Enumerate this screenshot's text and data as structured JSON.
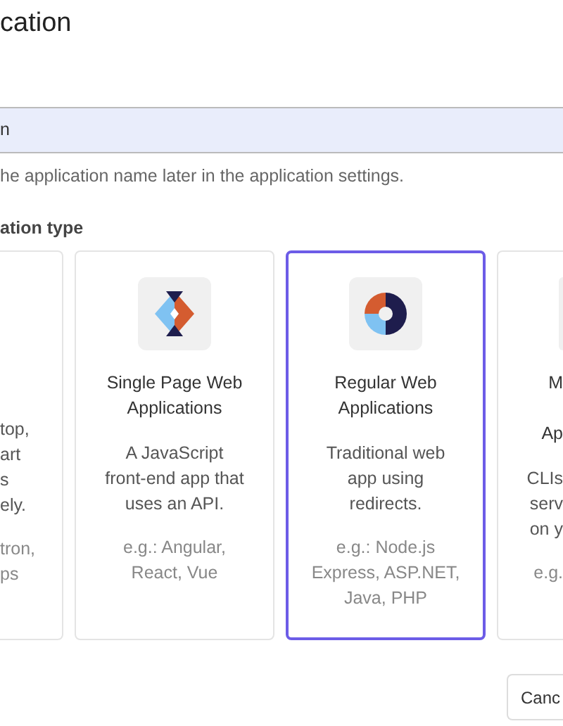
{
  "dialog_title": "cation",
  "name_field": {
    "value": "n"
  },
  "helper_text": "he application name later in the application settings.",
  "type_label": "ation type",
  "app_types": [
    {
      "kind": "cut-left",
      "selected": false,
      "description": "top,\nart\ns\nely.",
      "example": "tron,\nps"
    },
    {
      "kind": "full",
      "selected": false,
      "title": "Single Page Web\nApplications",
      "description": "A JavaScript\nfront-end app that\nuses an API.",
      "example": "e.g.: Angular,\nReact, Vue"
    },
    {
      "kind": "full",
      "selected": true,
      "title": "Regular Web\nApplications",
      "description": "Traditional web\napp using\nredirects.",
      "example": "e.g.: Node.js\nExpress, ASP.NET,\nJava, PHP"
    },
    {
      "kind": "cut-right",
      "selected": false,
      "title": "M\n\nAp",
      "description": "CLIs\nserv\non y",
      "example": "e.g."
    }
  ],
  "cancel_button": "Canc"
}
